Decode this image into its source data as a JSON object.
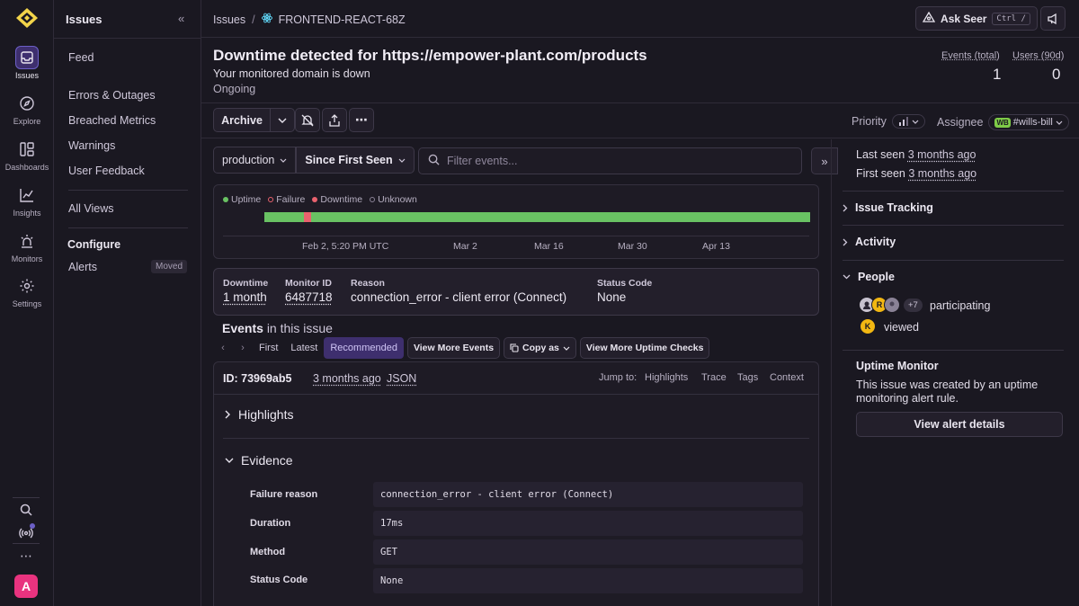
{
  "rail": {
    "items": [
      {
        "label": "Issues",
        "icon": "inbox-icon"
      },
      {
        "label": "Explore",
        "icon": "compass-icon"
      },
      {
        "label": "Dashboards",
        "icon": "dashboard-icon"
      },
      {
        "label": "Insights",
        "icon": "chart-icon"
      },
      {
        "label": "Monitors",
        "icon": "siren-icon"
      },
      {
        "label": "Settings",
        "icon": "gear-icon"
      }
    ],
    "user_initial": "A",
    "accent": "#6c5fc7"
  },
  "sidebar": {
    "title": "Issues",
    "feed": "Feed",
    "links": [
      "Errors & Outages",
      "Breached Metrics",
      "Warnings",
      "User Feedback"
    ],
    "all_views": "All Views",
    "configure": "Configure",
    "alerts": "Alerts",
    "moved_badge": "Moved"
  },
  "topbar": {
    "crumb_root": "Issues",
    "crumb_project": "FRONTEND-REACT-68Z",
    "ask_seer": "Ask Seer",
    "shortcut": "Ctrl /"
  },
  "issue": {
    "title": "Downtime detected for https://empower-plant.com/products",
    "subtitle": "Your monitored domain is down",
    "status": "Ongoing",
    "events_label": "Events (total)",
    "events_value": "1",
    "users_label": "Users (90d)",
    "users_value": "0"
  },
  "actions": {
    "archive": "Archive",
    "priority_label": "Priority",
    "assignee_label": "Assignee",
    "assignee_badge": "WB",
    "assignee_value": "#wills-bill"
  },
  "filters": {
    "environment": "production",
    "date_range": "Since First Seen",
    "search_placeholder": "Filter events..."
  },
  "timeline": {
    "legend": [
      "Uptime",
      "Failure",
      "Downtime",
      "Unknown"
    ],
    "ticks": [
      "Feb 2, 5:20 PM UTC",
      "Mar 2",
      "Mar 16",
      "Mar 30",
      "Apr 13"
    ],
    "colors": {
      "uptime": "#69c263",
      "failure": "#e9626e",
      "downtime": "#e9626e",
      "unknown": "#8a8296"
    }
  },
  "meta": {
    "downtime_label": "Downtime",
    "downtime_value": "1 month",
    "monitor_label": "Monitor ID",
    "monitor_value": "6487718",
    "reason_label": "Reason",
    "reason_value": "connection_error - client error (Connect)",
    "status_label": "Status Code",
    "status_value": "None"
  },
  "events": {
    "heading": "Events",
    "heading_suffix": "in this issue",
    "first": "First",
    "latest": "Latest",
    "recommended": "Recommended",
    "view_more_events": "View More Events",
    "copy_as": "Copy as",
    "view_more_checks": "View More Uptime Checks"
  },
  "event": {
    "id": "ID: 73969ab5",
    "ago": "3 months ago",
    "json": "JSON",
    "jump_to": "Jump to:",
    "jump_links": [
      "Highlights",
      "Trace",
      "Tags",
      "Context"
    ],
    "highlights": "Highlights",
    "evidence": "Evidence",
    "rows": [
      {
        "label": "Failure reason",
        "value": "connection_error - client error (Connect)"
      },
      {
        "label": "Duration",
        "value": "17ms"
      },
      {
        "label": "Method",
        "value": "GET"
      },
      {
        "label": "Status Code",
        "value": "None"
      }
    ]
  },
  "right": {
    "last_seen_label": "Last seen",
    "last_seen_value": "3 months ago",
    "first_seen_label": "First seen",
    "first_seen_value": "3 months ago",
    "issue_tracking": "Issue Tracking",
    "activity": "Activity",
    "people": "People",
    "participants_more": "+7",
    "participating": "participating",
    "viewer_initial": "K",
    "viewed": "viewed",
    "uptime_monitor": "Uptime Monitor",
    "uptime_desc": "This issue was created by an uptime monitoring alert rule.",
    "view_alert": "View alert details"
  }
}
